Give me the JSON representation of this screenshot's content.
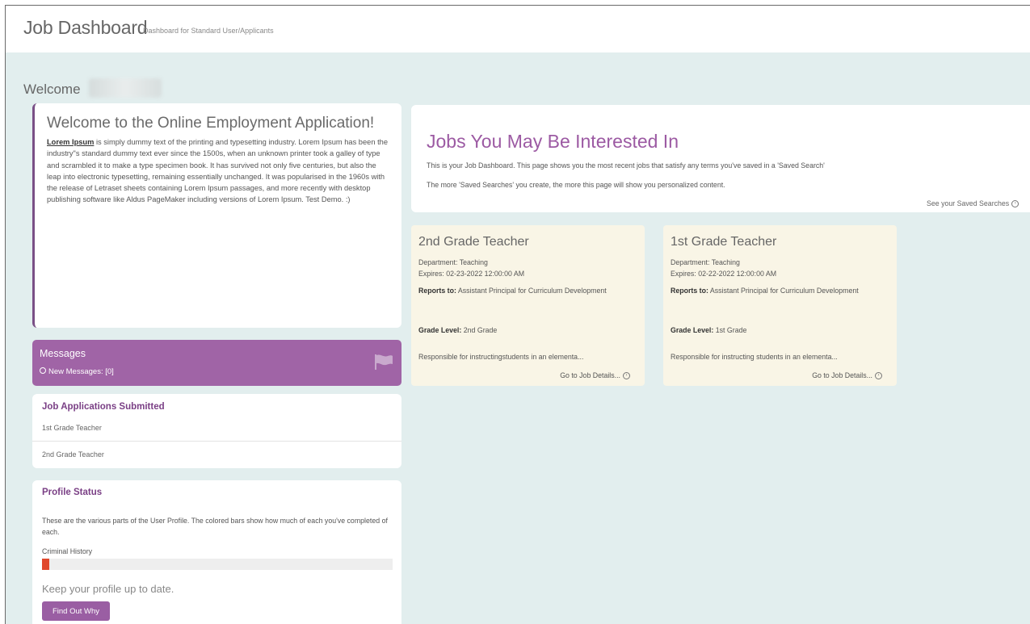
{
  "header": {
    "title": "Job Dashboard",
    "subtitle": "Dashboard for Standard User/Applicants"
  },
  "welcome": {
    "label": "Welcome"
  },
  "intro": {
    "title": "Welcome to the Online Employment Application!",
    "lead": "Lorem Ipsum",
    "body": " is simply dummy text of the printing and typesetting industry. Lorem Ipsum has been the industry\"s standard dummy text ever since the 1500s, when an unknown printer took a galley of type and scrambled it to make a type specimen book. It has survived not only five centuries, but also the leap into electronic typesetting, remaining essentially unchanged. It was popularised in the 1960s with the release of Letraset sheets containing Lorem Ipsum passages, and more recently with desktop publishing software like Aldus PageMaker including versions of Lorem Ipsum. Test Demo. :)"
  },
  "messages": {
    "title": "Messages",
    "new_messages": "New Messages: [0]",
    "icon": "flag-icon"
  },
  "applications": {
    "title": "Job Applications Submitted",
    "items": [
      "1st Grade Teacher",
      "2nd Grade Teacher"
    ]
  },
  "profile": {
    "title": "Profile Status",
    "description": "These are the various parts of the User Profile. The colored bars show how much of each you've completed of each.",
    "sections": [
      {
        "label": "Criminal History",
        "percent": 2
      }
    ],
    "bar_color": "#e0482d",
    "reminder": "Keep your profile up to date.",
    "button_label": "Find Out Why"
  },
  "interest": {
    "title": "Jobs You May Be Interested In",
    "line1": "This is your Job Dashboard. This page shows you the most recent jobs that satisfy any terms you've saved in a 'Saved Search'",
    "line2": "The more 'Saved Searches' you create, the more this page will show you personalized content.",
    "saved_link": "See your Saved Searches"
  },
  "jobs": [
    {
      "title": "2nd Grade Teacher",
      "department": "Department: Teaching",
      "expires": "Expires: 02-23-2022 12:00:00 AM",
      "reports_label": "Reports to:",
      "reports_value": " Assistant Principal for Curriculum Development",
      "grade_label": "Grade Level:",
      "grade_value": " 2nd Grade",
      "summary": "Responsible for instructingstudents in an elementa...",
      "link": "Go to Job Details..."
    },
    {
      "title": "1st Grade Teacher",
      "department": "Department: Teaching",
      "expires": "Expires: 02-22-2022 12:00:00 AM",
      "reports_label": "Reports to:",
      "reports_value": " Assistant Principal for Curriculum Development",
      "grade_label": "Grade Level:",
      "grade_value": " 1st Grade",
      "summary": "Responsible for instructing students in an elementa...",
      "link": "Go to Job Details..."
    }
  ],
  "colors": {
    "accent": "#9c5aa3",
    "messages_bg": "#a064a6",
    "page_bg": "#e2eeee",
    "job_card_bg": "#f9f5e6"
  }
}
